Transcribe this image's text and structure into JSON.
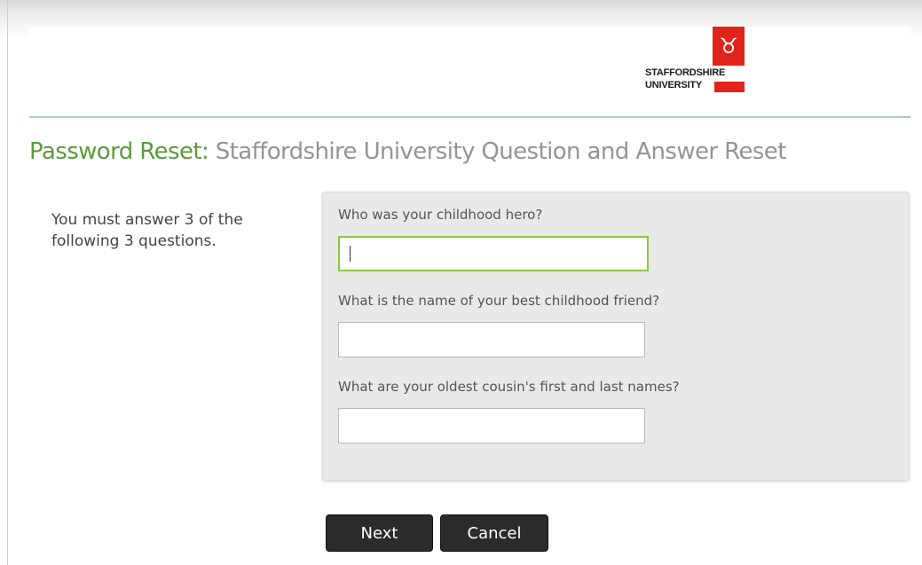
{
  "logo": {
    "line1": "STAFFORDSHIRE",
    "line2": "UNIVERSITY",
    "mark": "♉",
    "brand_color": "#e2231a"
  },
  "title": {
    "lead": "Password Reset:",
    "rest": " Staffordshire University Question and Answer Reset",
    "lead_color": "#5c9a3c"
  },
  "instructions": "You must answer 3 of the following 3 questions.",
  "questions": [
    {
      "label": "Who was your childhood hero?",
      "value": "",
      "focused": true
    },
    {
      "label": "What is the name of your best childhood friend?",
      "value": ""
    },
    {
      "label": "What are your oldest cousin's first and last names?",
      "value": ""
    }
  ],
  "buttons": {
    "next": "Next",
    "cancel": "Cancel"
  },
  "colors": {
    "focus_border": "#8dc63f",
    "header_rule": "#a9cbd8",
    "button_bg": "#2b2b2b"
  }
}
